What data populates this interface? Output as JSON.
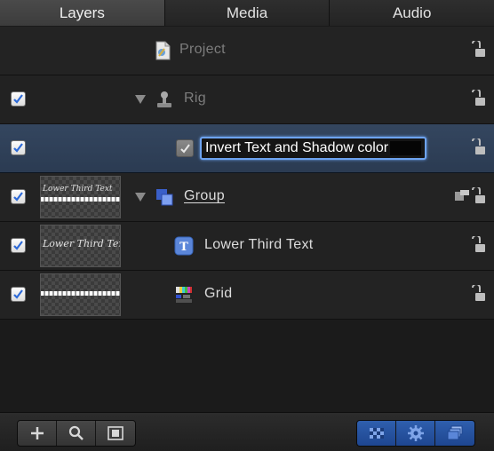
{
  "tabs": [
    {
      "label": "Layers",
      "active": true
    },
    {
      "label": "Media",
      "active": false
    },
    {
      "label": "Audio",
      "active": false
    }
  ],
  "layers": [
    {
      "name": "Project",
      "icon": "project-document-icon",
      "checked": null,
      "thumbnail": false
    },
    {
      "name": "Rig",
      "icon": "rig-joystick-icon",
      "checked": true,
      "thumbnail": false,
      "expanded": true
    },
    {
      "name": "Invert Text and Shadow color",
      "icon": "widget-checkbox-icon",
      "checked": true,
      "thumbnail": false,
      "selected": true,
      "editing": true
    },
    {
      "name": "Group",
      "icon": "group-squares-icon",
      "checked": true,
      "thumbnail": true,
      "thumbnail_text": "Lower Third Text",
      "expanded": true
    },
    {
      "name": "Lower Third Text",
      "icon": "text-layer-icon",
      "checked": true,
      "thumbnail": true,
      "thumbnail_text": "Lower Third Text"
    },
    {
      "name": "Grid",
      "icon": "grid-generator-icon",
      "checked": true,
      "thumbnail": true
    }
  ],
  "footer": {
    "left_buttons": [
      "add-icon",
      "search-icon",
      "media-browser-icon"
    ],
    "right_buttons": [
      "checkerboard-icon",
      "gear-icon",
      "layers-stack-icon"
    ]
  },
  "colors": {
    "selection": "#34465f",
    "accent_blue": "#2f5fae",
    "edit_focus": "#6da3f0"
  }
}
